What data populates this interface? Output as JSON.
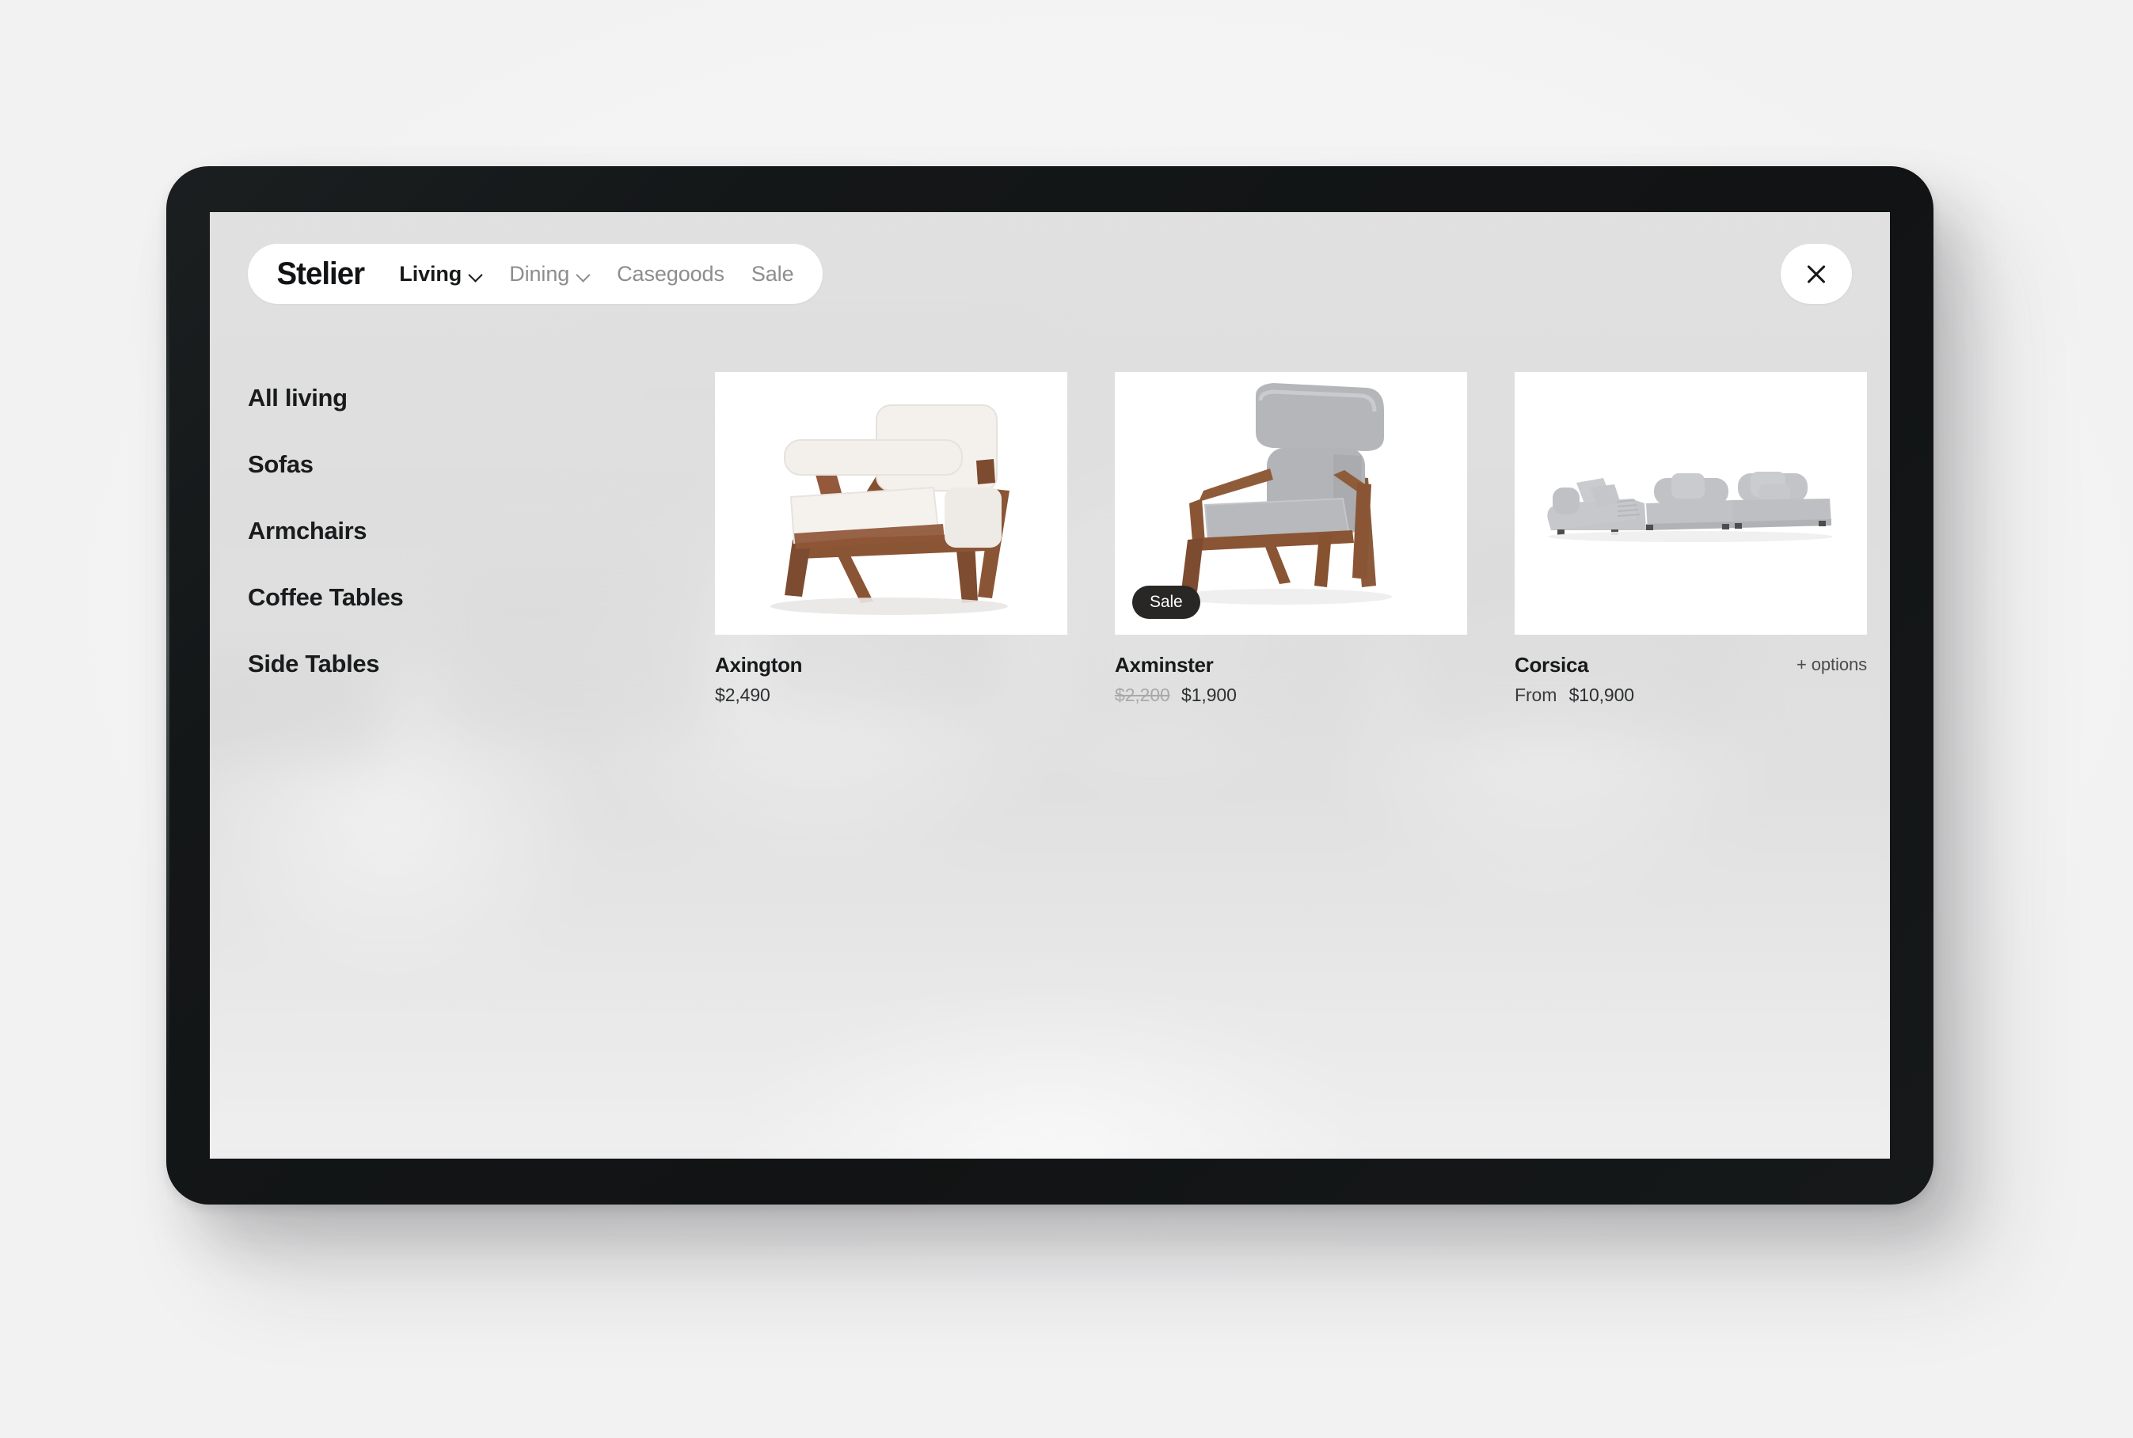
{
  "brand": "Stelier",
  "nav": {
    "links": [
      {
        "label": "Living",
        "active": true,
        "has_chevron": true
      },
      {
        "label": "Dining",
        "active": false,
        "has_chevron": true
      },
      {
        "label": "Casegoods",
        "active": false,
        "has_chevron": false
      },
      {
        "label": "Sale",
        "active": false,
        "has_chevron": false
      }
    ],
    "close_label": "Close"
  },
  "sidebar": {
    "items": [
      {
        "label": "All living"
      },
      {
        "label": "Sofas"
      },
      {
        "label": "Armchairs"
      },
      {
        "label": "Coffee Tables"
      },
      {
        "label": "Side Tables"
      }
    ]
  },
  "products": [
    {
      "name": "Axington",
      "price": "$2,490",
      "old_price": "",
      "price_prefix": "",
      "badge": "",
      "options": "",
      "image_alt": "white-boucle-armchair-walnut-frame"
    },
    {
      "name": "Axminster",
      "price": "$1,900",
      "old_price": "$2,200",
      "price_prefix": "",
      "badge": "Sale",
      "options": "",
      "image_alt": "grey-highback-lounge-chair-walnut-frame"
    },
    {
      "name": "Corsica",
      "price": "$10,900",
      "old_price": "",
      "price_prefix": "From",
      "badge": "",
      "options": "+ options",
      "image_alt": "grey-modular-sectional-sofa"
    }
  ],
  "colors": {
    "ink": "#17191a",
    "muted": "#8d8d8d",
    "badge_bg": "#282725",
    "card_bg": "#ffffff",
    "screen_bg": "#e3e3e3",
    "device_bezel": "#141718",
    "walnut": "#8a5535",
    "boucle_white": "#f2efeb",
    "fabric_grey": "#b9bbbe"
  }
}
